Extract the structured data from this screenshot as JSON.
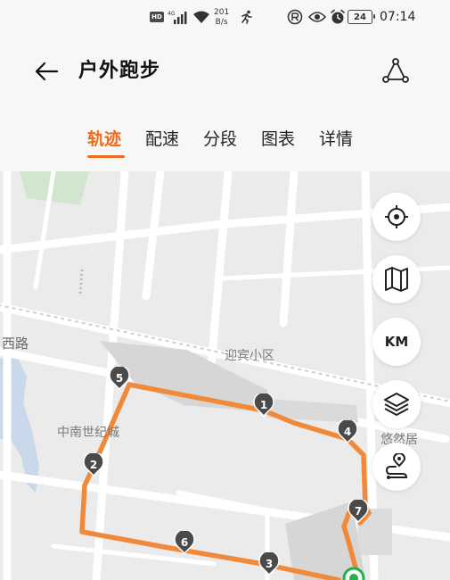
{
  "status_bar": {
    "hd": "HD",
    "network": "4G",
    "speed_value": "201",
    "speed_unit": "B/s",
    "battery": "24",
    "time": "07:14"
  },
  "header": {
    "title": "户外跑步"
  },
  "tabs": [
    {
      "label": "轨迹",
      "active": true
    },
    {
      "label": "配速",
      "active": false
    },
    {
      "label": "分段",
      "active": false
    },
    {
      "label": "图表",
      "active": false
    },
    {
      "label": "详情",
      "active": false
    }
  ],
  "map": {
    "labels": {
      "road": "西路",
      "residential_1": "迎宾小区",
      "residential_2": "中南世纪城",
      "residential_3": "悠然居"
    },
    "controls": {
      "km_label": "KM"
    },
    "km_markers": [
      "1",
      "2",
      "3",
      "4",
      "5",
      "6",
      "7"
    ],
    "route_color": "#f08a3a",
    "marker_color": "#4a4a4a",
    "start_color": "#22b14c"
  },
  "colors": {
    "accent": "#ee6a1e"
  }
}
